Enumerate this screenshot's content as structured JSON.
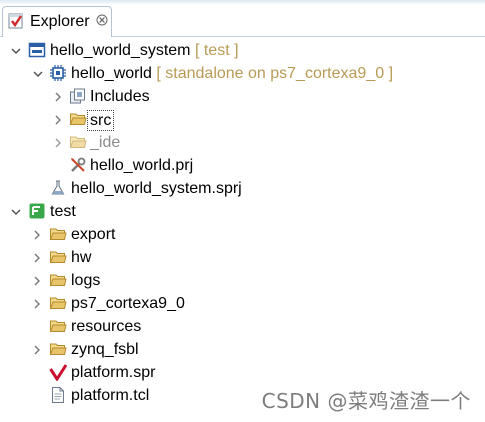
{
  "tab": {
    "label": "Explorer",
    "icon": "explorer-icon",
    "close_icon": "close-icon"
  },
  "tree": {
    "system": {
      "name": "hello_world_system",
      "decoration": "[ test ]",
      "icon": "system-project-icon",
      "expanded": true,
      "application": {
        "name": "hello_world",
        "decoration": "[ standalone on ps7_cortexa9_0 ]",
        "icon": "application-project-icon",
        "expanded": true,
        "children": [
          {
            "name": "Includes",
            "icon": "includes-icon",
            "expandable": true
          },
          {
            "name": "src",
            "icon": "folder-icon",
            "expandable": true,
            "selected": true
          },
          {
            "name": "_ide",
            "icon": "folder-icon",
            "expandable": true,
            "muted": true
          },
          {
            "name": "hello_world.prj",
            "icon": "project-tools-icon",
            "expandable": false
          }
        ]
      },
      "sprj": {
        "name": "hello_world_system.sprj",
        "icon": "flask-icon"
      }
    },
    "platform": {
      "name": "test",
      "icon": "platform-project-icon",
      "expanded": true,
      "children": [
        {
          "name": "export",
          "icon": "folder-icon",
          "expandable": true
        },
        {
          "name": "hw",
          "icon": "folder-icon",
          "expandable": true
        },
        {
          "name": "logs",
          "icon": "folder-icon",
          "expandable": true
        },
        {
          "name": "ps7_cortexa9_0",
          "icon": "folder-icon",
          "expandable": true
        },
        {
          "name": "resources",
          "icon": "folder-icon",
          "expandable": false
        },
        {
          "name": "zynq_fsbl",
          "icon": "folder-icon",
          "expandable": true
        },
        {
          "name": "platform.spr",
          "icon": "vitis-logo-icon",
          "expandable": false
        },
        {
          "name": "platform.tcl",
          "icon": "file-icon",
          "expandable": false
        }
      ]
    }
  },
  "watermark": "CSDN @菜鸡渣渣一个",
  "colors": {
    "decoration": "#b89a54",
    "folder": "#e8c46a",
    "platform_green": "#3aa84a",
    "system_blue": "#2a5fa8"
  }
}
